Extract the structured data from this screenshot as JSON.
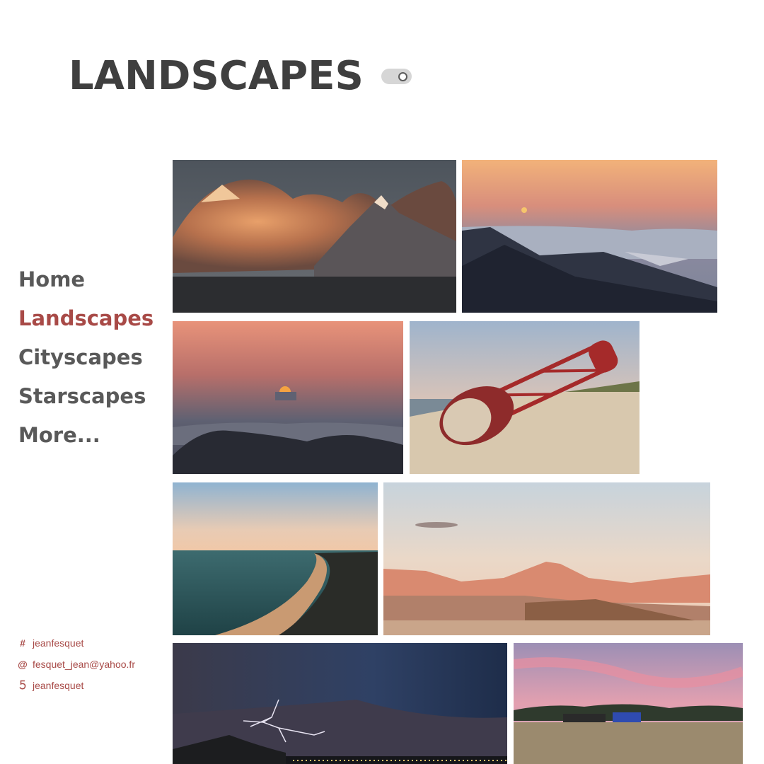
{
  "header": {
    "title": "LANDSCAPES",
    "theme_toggle": {
      "state": "off"
    }
  },
  "nav": {
    "items": [
      {
        "label": "Home",
        "active": false
      },
      {
        "label": "Landscapes",
        "active": true
      },
      {
        "label": "Cityscapes",
        "active": false
      },
      {
        "label": "Starscapes",
        "active": false
      },
      {
        "label": "More..."
      }
    ]
  },
  "contacts": [
    {
      "icon": "hashtag-icon",
      "text": "jeanfesquet"
    },
    {
      "icon": "at-sign-icon",
      "text": "fesquet_jean@yahoo.fr"
    },
    {
      "icon": "500px-icon",
      "text": "jeanfesquet"
    }
  ],
  "gallery": {
    "photos": [
      {
        "subject": "mountain-clouds-sunset"
      },
      {
        "subject": "mountain-valley-dawn"
      },
      {
        "subject": "sunset-over-ridges"
      },
      {
        "subject": "beached-buoy"
      },
      {
        "subject": "coastline-beach"
      },
      {
        "subject": "desert-volcano"
      },
      {
        "subject": "lightning-storm"
      },
      {
        "subject": "field-tractor-pink-sky"
      }
    ]
  },
  "colors": {
    "accent": "#a84a47",
    "text": "#3f3f3f",
    "nav_text": "#595959"
  }
}
